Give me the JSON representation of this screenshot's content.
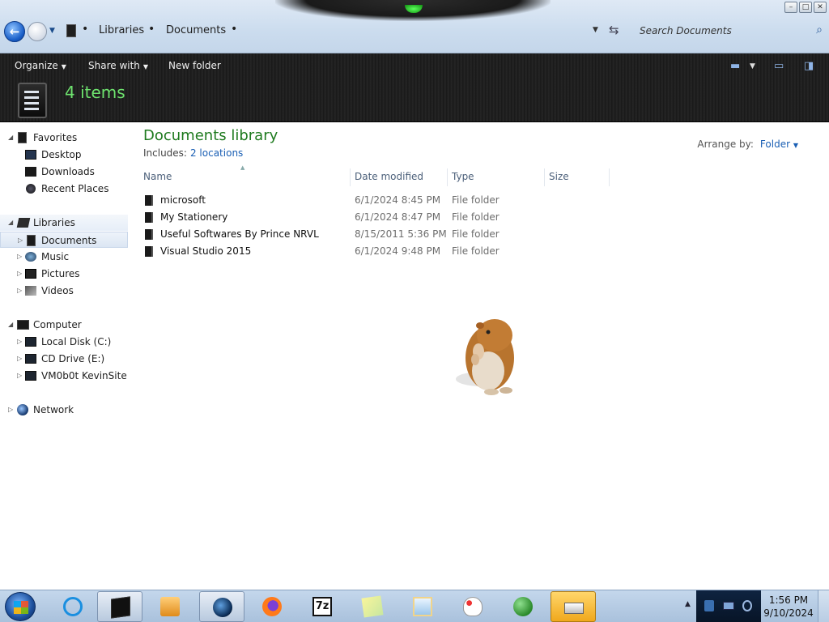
{
  "window": {
    "controls": {
      "minimize": "–",
      "maximize": "□",
      "close": "✕"
    }
  },
  "address": {
    "breadcrumb": [
      "Libraries",
      "Documents"
    ],
    "separator": "•",
    "search_placeholder": "Search Documents"
  },
  "toolbar": {
    "organize_label": "Organize",
    "share_label": "Share with",
    "new_folder_label": "New folder",
    "item_count": "4 items"
  },
  "nav": {
    "favorites": {
      "label": "Favorites",
      "items": [
        "Desktop",
        "Downloads",
        "Recent Places"
      ]
    },
    "libraries": {
      "label": "Libraries",
      "items": [
        "Documents",
        "Music",
        "Pictures",
        "Videos"
      ]
    },
    "computer": {
      "label": "Computer",
      "items": [
        "Local Disk (C:)",
        "CD Drive (E:)",
        "VM0b0t KevinSite"
      ]
    },
    "network": {
      "label": "Network"
    }
  },
  "library": {
    "title": "Documents library",
    "includes_label": "Includes:",
    "includes_link": "2 locations",
    "arrange_label": "Arrange by:",
    "arrange_value": "Folder"
  },
  "columns": {
    "name": "Name",
    "date": "Date modified",
    "type": "Type",
    "size": "Size"
  },
  "files": [
    {
      "name": "microsoft",
      "date": "6/1/2024 8:45 PM",
      "type": "File folder"
    },
    {
      "name": "My Stationery",
      "date": "6/1/2024 8:47 PM",
      "type": "File folder"
    },
    {
      "name": "Useful Softwares By Prince NRVL",
      "date": "8/15/2011 5:36 PM",
      "type": "File folder"
    },
    {
      "name": "Visual Studio 2015",
      "date": "6/1/2024 9:48 PM",
      "type": "File folder"
    }
  ],
  "taskbar": {
    "time": "1:56 PM",
    "date": "9/10/2024"
  },
  "colors": {
    "accent_green": "#6ee36e",
    "title_green": "#1e7a1e",
    "link_blue": "#1a5fb4",
    "toolbar_dark": "#1b1b1b"
  }
}
